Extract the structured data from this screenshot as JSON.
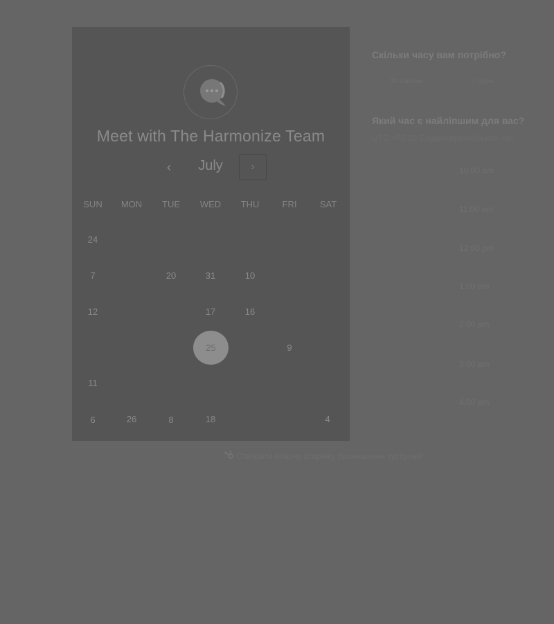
{
  "calendar": {
    "title": "Meet with The Harmonize Team",
    "month": "July",
    "prev_glyph": "‹",
    "next_glyph": "›",
    "weekdays": [
      "SUN",
      "MON",
      "TUE",
      "WED",
      "THU",
      "FRI",
      "SAT"
    ],
    "days": [
      "24",
      "7",
      "20",
      "31",
      "10",
      "12",
      "17",
      "16",
      "9",
      "11",
      "6",
      "26",
      "8",
      "18",
      "4"
    ],
    "selected_day": "25"
  },
  "duration": {
    "question": "Скільки часу вам потрібно?",
    "options": [
      "30 хвилин",
      "1 годин"
    ]
  },
  "time": {
    "question": "Який час є найліпшим для вас?",
    "timezone": "UTC +03:00 Східноєвропейський час",
    "slots": [
      "10:00 am",
      "11:00 am",
      "12:00 pm",
      "1:00 pm",
      "2:00 pm",
      "3:00 pm",
      "4:00 pm"
    ]
  },
  "footer": {
    "create_link": "Створити власну сторінку бронювання зустрічей",
    "create_icon": "sprocket-icon"
  },
  "colors": {
    "page_background": "#656565",
    "card_background": "#555555",
    "selected_day": "#8d8d8d"
  }
}
